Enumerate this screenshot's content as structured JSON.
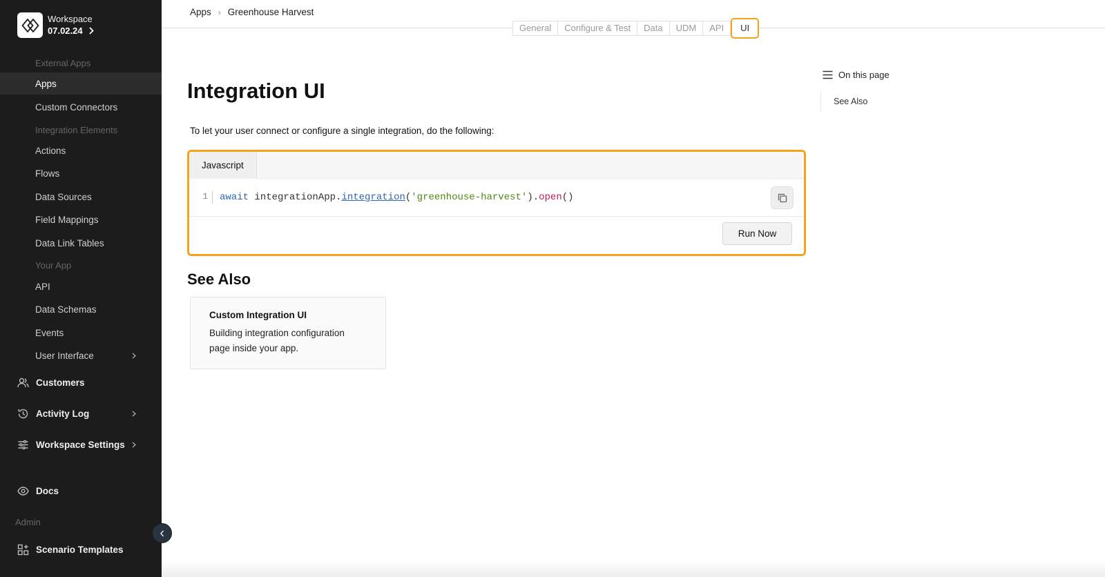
{
  "workspace": {
    "name": "Workspace",
    "version": "07.02.24"
  },
  "sidebar": {
    "sections": {
      "external_apps": "External Apps",
      "integration_elements": "Integration Elements",
      "your_app": "Your App",
      "admin": "Admin"
    },
    "external_items": [
      "Apps",
      "Custom Connectors"
    ],
    "integration_items": [
      "Actions",
      "Flows",
      "Data Sources",
      "Field Mappings",
      "Data Link Tables"
    ],
    "your_app_items": [
      "API",
      "Data Schemas",
      "Events",
      "User Interface"
    ],
    "top_items": {
      "customers": "Customers",
      "activity_log": "Activity Log",
      "workspace_settings": "Workspace Settings",
      "docs": "Docs",
      "scenario_templates": "Scenario Templates"
    },
    "active_item": "Apps"
  },
  "breadcrumb": {
    "root": "Apps",
    "current": "Greenhouse Harvest"
  },
  "tabs": [
    "General",
    "Configure & Test",
    "Data",
    "UDM",
    "API",
    "UI"
  ],
  "active_tab": "UI",
  "main": {
    "title": "Integration UI",
    "intro": "To let your user connect or configure a single integration, do the following:",
    "code": {
      "language_tab": "Javascript",
      "line_number": "1",
      "tokens": {
        "await": "await",
        "obj": "integrationApp",
        "dot1": ".",
        "fn": "integration",
        "open_paren": "(",
        "arg": "'greenhouse-harvest'",
        "close_dot": ").",
        "method": "open",
        "call": "()"
      },
      "run_label": "Run Now"
    },
    "see_also": {
      "heading": "See Also",
      "card_title": "Custom Integration UI",
      "card_desc_1": "Building integration configuration",
      "card_desc_2": "page inside your app."
    }
  },
  "on_this_page": {
    "label": "On this page",
    "items": [
      "See Also"
    ]
  },
  "colors": {
    "sidebar_bg": "#1c1c1c",
    "accent": "#f7a21b",
    "keyword": "#2b66b7",
    "string": "#4f8a10",
    "method": "#c2185b"
  }
}
